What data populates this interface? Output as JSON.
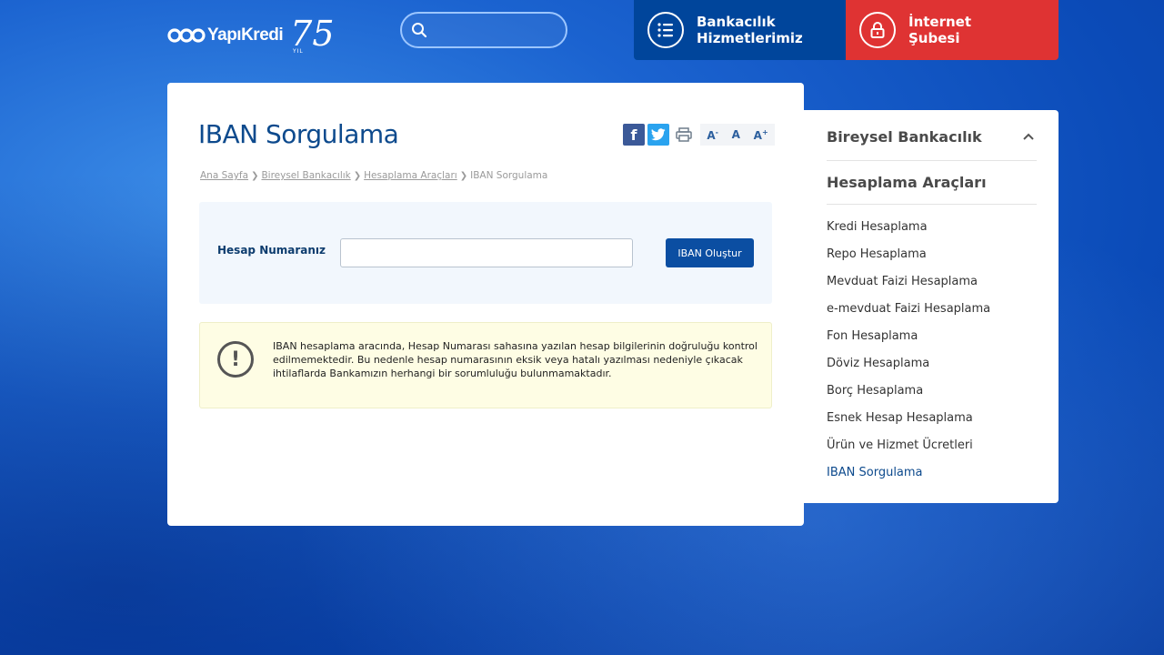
{
  "header": {
    "logo_text": "YapıKredi",
    "logo_anniversary": "75",
    "logo_yil": "YIL",
    "search_placeholder": "",
    "banking_label_1": "Bankacılık",
    "banking_label_2": "Hizmetlerimiz",
    "internet_label_1": "İnternet",
    "internet_label_2": "Şubesi"
  },
  "page": {
    "title": "IBAN Sorgulama",
    "breadcrumb": [
      "Ana Sayfa",
      "Bireysel Bankacılık",
      "Hesaplama Araçları",
      "IBAN Sorgulama"
    ],
    "font_small": "A",
    "font_normal": "A",
    "font_large": "A"
  },
  "form": {
    "label": "Hesap Numaranız",
    "input_value": "",
    "button_label": "IBAN Oluştur"
  },
  "alert": {
    "text": "IBAN hesaplama aracında, Hesap Numarası sahasına yazılan hesap bilgilerinin doğruluğu kontrol edilmemektedir. Bu nedenle hesap numarasının eksik veya hatalı yazılması nedeniyle çıkacak ihtilaflarda Bankamızın herhangi bir sorumluluğu bulunmamaktadır."
  },
  "sidebar": {
    "heading": "Bireysel Bankacılık",
    "subheading": "Hesaplama Araçları",
    "items": [
      {
        "label": "Kredi Hesaplama",
        "active": false
      },
      {
        "label": "Repo Hesaplama",
        "active": false
      },
      {
        "label": "Mevduat Faizi Hesaplama",
        "active": false
      },
      {
        "label": "e-mevduat Faizi Hesaplama",
        "active": false
      },
      {
        "label": "Fon Hesaplama",
        "active": false
      },
      {
        "label": "Döviz Hesaplama",
        "active": false
      },
      {
        "label": "Borç Hesaplama",
        "active": false
      },
      {
        "label": "Esnek Hesap Hesaplama",
        "active": false
      },
      {
        "label": "Ürün ve Hizmet Ücretleri",
        "active": false
      },
      {
        "label": "IBAN Sorgulama",
        "active": true
      }
    ]
  },
  "colors": {
    "brand_blue": "#0d4a8d",
    "banking_bg": "#00459b",
    "internet_bg": "#df3333"
  }
}
